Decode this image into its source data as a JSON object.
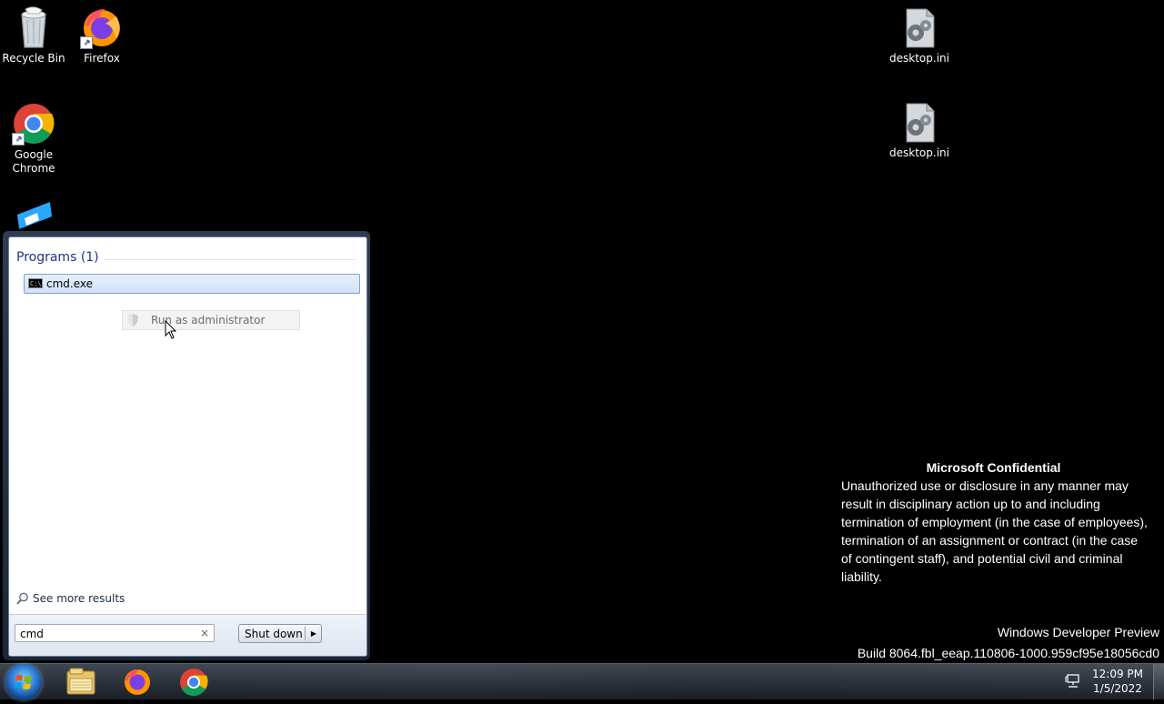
{
  "desktop": {
    "icons": [
      {
        "id": "recycle-bin",
        "label": "Recycle Bin"
      },
      {
        "id": "firefox",
        "label": "Firefox"
      },
      {
        "id": "google-chrome",
        "label": "Google Chrome"
      },
      {
        "id": "desktop-ini-1",
        "label": "desktop.ini"
      },
      {
        "id": "desktop-ini-2",
        "label": "desktop.ini"
      }
    ]
  },
  "start_menu": {
    "heading": "Programs (1)",
    "result_item": "cmd.exe",
    "context_action": "Run as administrator",
    "see_more": "See more results",
    "search_value": "cmd",
    "search_clear": "×",
    "shutdown_label": "Shut down",
    "shutdown_arrow": "▶"
  },
  "notice": {
    "title": "Microsoft Confidential",
    "body": "Unauthorized use or disclosure in any manner may result in disciplinary action up to and including termination of employment (in the case of employees), termination of an assignment or contract (in the case of contingent staff), and potential civil and criminal liability.",
    "preview_line1": "Windows Developer Preview",
    "preview_line2": "Build 8064.fbl_eeap.110806-1000.959cf95e18056cd0"
  },
  "taskbar": {
    "pinned": [
      "file-explorer-icon",
      "firefox-icon",
      "chrome-icon"
    ],
    "time": "12:09 PM",
    "date": "1/5/2022"
  },
  "colors": {
    "desktop_bg": "#000000",
    "heading_blue": "#1e3287",
    "selection_border": "#7da2ce"
  }
}
